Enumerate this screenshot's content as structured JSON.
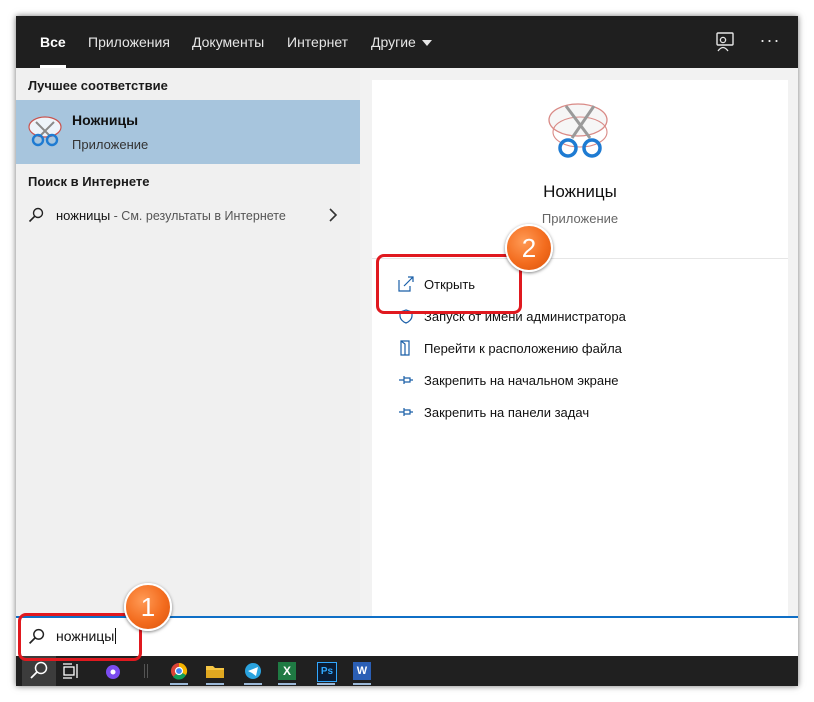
{
  "tabs": [
    {
      "label": "Все",
      "active": true
    },
    {
      "label": "Приложения"
    },
    {
      "label": "Документы"
    },
    {
      "label": "Интернет"
    },
    {
      "label": "Другие"
    }
  ],
  "top_icons": [
    "feedback-icon",
    "more-options-icon"
  ],
  "more_glyph": "···",
  "left": {
    "best_match_title": "Лучшее соответствие",
    "best_match": {
      "name": "Ножницы",
      "type": "Приложение"
    },
    "web_title": "Поиск в Интернете",
    "web_result": {
      "query": "ножницы",
      "suffix": " - См. результаты в Интернете"
    }
  },
  "right": {
    "app_name": "Ножницы",
    "app_type": "Приложение",
    "actions": [
      {
        "label": "Открыть",
        "icon": "open-icon"
      },
      {
        "label": "Запуск от имени администратора",
        "icon": "shield-icon"
      },
      {
        "label": "Перейти к расположению файла",
        "icon": "file-location-icon"
      },
      {
        "label": "Закрепить на начальном экране",
        "icon": "pin-icon"
      },
      {
        "label": "Закрепить на панели задач",
        "icon": "pin-icon"
      }
    ]
  },
  "search": {
    "value": "ножницы"
  },
  "taskbar_icons": [
    "search-icon",
    "task-view-icon",
    "alice-icon",
    "chrome-icon",
    "file-explorer-icon",
    "telegram-icon",
    "excel-icon",
    "photoshop-icon",
    "word-icon"
  ],
  "taskbar_glyphs": {
    "excel": "X",
    "photoshop": "Ps",
    "word": "W"
  },
  "annotations": {
    "step1": "1",
    "step2": "2"
  },
  "colors": {
    "accent": "#0f6fc6",
    "selection": "#a7c5dd",
    "topbar": "#1f1f1f",
    "highlight": "#e0191f",
    "badge": "#f36c1e"
  }
}
